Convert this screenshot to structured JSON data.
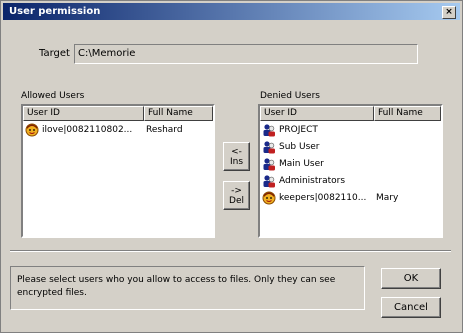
{
  "window": {
    "title": "User permission",
    "close_glyph": "×"
  },
  "target": {
    "label": "Target",
    "value": "C:\\Memorie"
  },
  "allowed": {
    "label": "Allowed Users",
    "columns": [
      "User ID",
      "Full Name"
    ],
    "rows": [
      {
        "id": "ilove|0082110802...",
        "fullname": "Reshard",
        "icon": "user-face-icon"
      }
    ]
  },
  "denied": {
    "label": "Denied Users",
    "columns": [
      "User ID",
      "Full Name"
    ],
    "rows": [
      {
        "id": "PROJECT",
        "fullname": "",
        "icon": "user-group-icon"
      },
      {
        "id": "Sub User",
        "fullname": "",
        "icon": "user-group-icon"
      },
      {
        "id": "Main User",
        "fullname": "",
        "icon": "user-group-icon"
      },
      {
        "id": "Administrators",
        "fullname": "",
        "icon": "user-group-icon"
      },
      {
        "id": "keepers|0082110...",
        "fullname": "Mary",
        "icon": "user-face-icon"
      }
    ]
  },
  "buttons": {
    "ins_arrow": "<-",
    "ins_label": "Ins",
    "del_arrow": "->",
    "del_label": "Del",
    "ok": "OK",
    "cancel": "Cancel"
  },
  "info": {
    "text": "Please select users who you allow to access to files. Only they can see encrypted files."
  },
  "colors": {
    "titlebar_start": "#0a246a",
    "titlebar_end": "#a6caf0",
    "face": "#d4d0c8"
  }
}
